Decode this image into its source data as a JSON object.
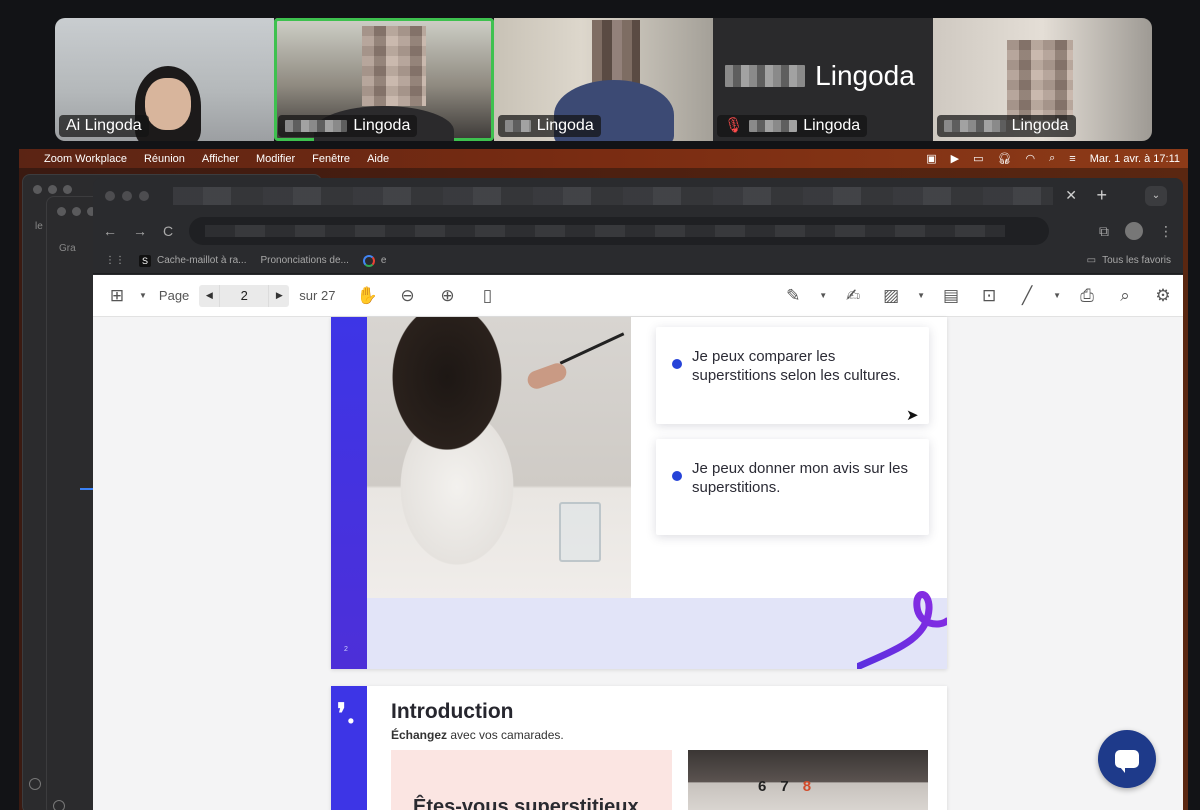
{
  "gallery": {
    "participants": [
      {
        "name": "Ai Lingoda",
        "muted": false,
        "speaking": false
      },
      {
        "name": "Lingoda",
        "muted": false,
        "speaking": true
      },
      {
        "name": "Lingoda",
        "muted": false,
        "speaking": false
      },
      {
        "name": "Lingoda",
        "muted": true,
        "speaking": false,
        "big_name": "Lingoda"
      },
      {
        "name": "Lingoda",
        "muted": false,
        "speaking": false
      }
    ]
  },
  "menubar": {
    "app": "Zoom Workplace",
    "menus": [
      "Réunion",
      "Afficher",
      "Modifier",
      "Fenêtre",
      "Aide"
    ],
    "datetime": "Mar. 1 avr. à 17:11"
  },
  "desktop": {
    "ghost1_label": "le",
    "ghost2_label": "Gra"
  },
  "bookmarks": {
    "items": [
      "Cache-maillot à ra...",
      "Prononciations de...",
      "e"
    ],
    "favorites": "Tous les favoris"
  },
  "pdf": {
    "page_label": "Page",
    "current_page": "2",
    "total_label": "sur 27"
  },
  "slide2": {
    "page_number": "2",
    "card1": "Je peux comparer les superstitions selon les cultures.",
    "card2": "Je peux donner mon avis sur les superstitions."
  },
  "slide3": {
    "title": "Introduction",
    "sub_bold": "Échangez",
    "sub_rest": " avec vos camarades.",
    "question": "Êtes-vous superstitieux",
    "calendar_digits": [
      "6",
      "7",
      "8"
    ]
  },
  "colors": {
    "accent": "#3d35e6",
    "speaking": "#3ec14f",
    "chat": "#1e3a8a"
  }
}
